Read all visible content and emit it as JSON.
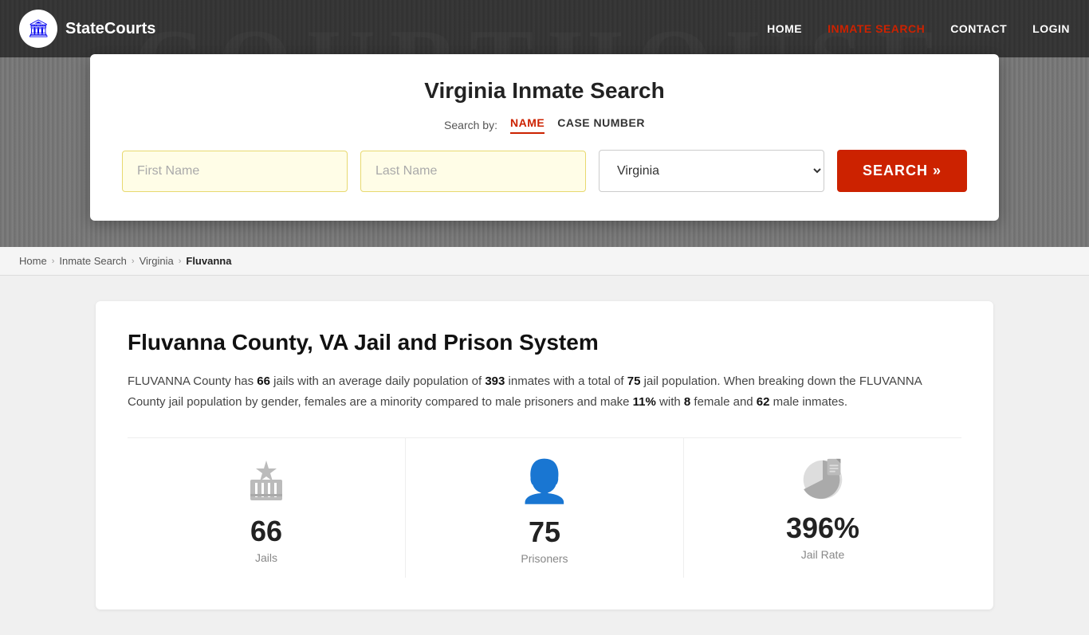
{
  "site": {
    "name": "StateCourts",
    "logo_icon": "🏛"
  },
  "nav": {
    "home": "HOME",
    "inmate_search": "INMATE SEARCH",
    "contact": "CONTACT",
    "login": "LOGIN"
  },
  "courthouse_bg": "COURTHOUSE",
  "search_card": {
    "title": "Virginia Inmate Search",
    "search_by_label": "Search by:",
    "tab_name": "NAME",
    "tab_case_number": "CASE NUMBER",
    "first_name_placeholder": "First Name",
    "last_name_placeholder": "Last Name",
    "state_value": "Virginia",
    "search_button": "SEARCH »"
  },
  "breadcrumb": {
    "home": "Home",
    "inmate_search": "Inmate Search",
    "state": "Virginia",
    "current": "Fluvanna"
  },
  "main": {
    "title": "Fluvanna County, VA Jail and Prison System",
    "description_parts": {
      "intro": "FLUVANNA County has ",
      "jails": "66",
      "jails_suffix": " jails with an average daily population of ",
      "avg_pop": "393",
      "avg_pop_suffix": " inmates with a total of ",
      "total": "75",
      "total_suffix": " jail population. When breaking down the FLUVANNA County jail population by gender, females are a minority compared to male prisoners and make ",
      "female_pct": "11%",
      "female_pct_suffix": " with ",
      "female_count": "8",
      "female_count_suffix": " female and ",
      "male_count": "62",
      "male_count_suffix": " male inmates."
    },
    "stats": [
      {
        "icon_type": "jail",
        "number": "66",
        "label": "Jails"
      },
      {
        "icon_type": "person",
        "number": "75",
        "label": "Prisoners"
      },
      {
        "icon_type": "pie",
        "number": "396%",
        "label": "Jail Rate"
      }
    ]
  }
}
